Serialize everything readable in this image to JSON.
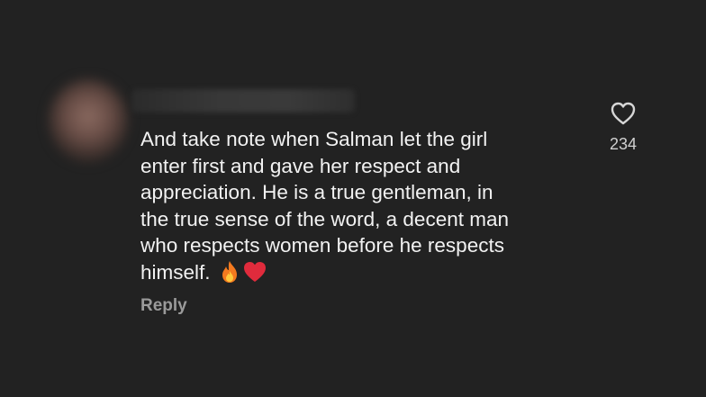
{
  "comment": {
    "lines": [
      "And take note when Salman let the girl",
      "enter first and gave her respect and",
      "appreciation. He is a true gentleman, in",
      "the true sense of the word, a decent man",
      "who respects women before he respects",
      "himself."
    ],
    "emojis": [
      "fire-emoji",
      "red-heart-emoji"
    ],
    "reply_label": "Reply"
  },
  "like": {
    "icon": "heart-outline-icon",
    "count": "234"
  },
  "colors": {
    "background": "#222222",
    "text": "#f2f2f2",
    "muted": "#9a9a9a"
  }
}
